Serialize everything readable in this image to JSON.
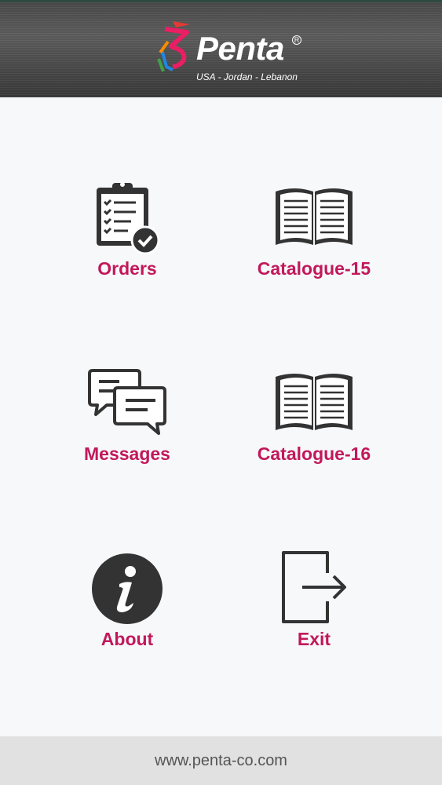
{
  "header": {
    "brand_name": "Penta",
    "brand_tagline": "USA - Jordan - Lebanon",
    "registered_mark": "R"
  },
  "menu": {
    "items": [
      {
        "label": "Orders",
        "icon": "clipboard-check-icon"
      },
      {
        "label": "Catalogue-15",
        "icon": "open-book-icon"
      },
      {
        "label": "Messages",
        "icon": "chat-bubbles-icon"
      },
      {
        "label": "Catalogue-16",
        "icon": "open-book-icon"
      },
      {
        "label": "About",
        "icon": "info-icon"
      },
      {
        "label": "Exit",
        "icon": "exit-icon"
      }
    ]
  },
  "footer": {
    "url": "www.penta-co.com"
  },
  "colors": {
    "accent": "#c2185b",
    "icon": "#333333",
    "header": "#4d4d4d",
    "footer": "#e1e1e1"
  }
}
